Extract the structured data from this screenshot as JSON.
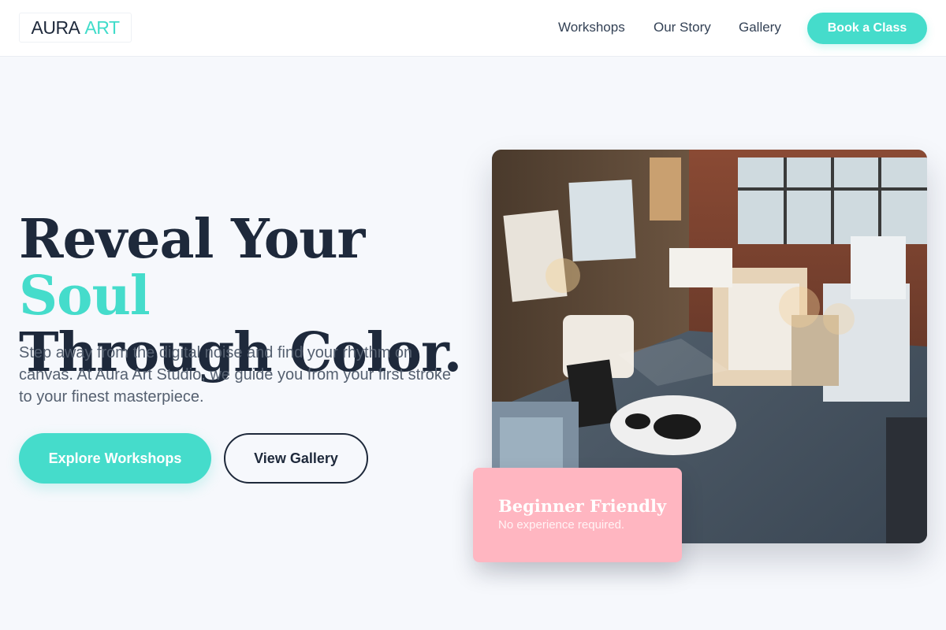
{
  "header": {
    "logo": {
      "word1": "AURA",
      "word2": "ART"
    },
    "nav": [
      {
        "label": "Workshops"
      },
      {
        "label": "Our Story"
      },
      {
        "label": "Gallery"
      }
    ],
    "cta_label": "Book a Class"
  },
  "hero": {
    "headline_part1": "Reveal Your ",
    "headline_accent": "Soul",
    "headline_part2": "Through Color.",
    "subtext": "Step away from the digital noise and find your rhythm on canvas. At Aura Art Studio, we guide you from your first stroke to your finest masterpiece.",
    "primary_button": "Explore Workshops",
    "secondary_button": "View Gallery",
    "image_icon": "art-studio-photo",
    "badge": {
      "title": "Beginner Friendly",
      "subtitle": "No experience required."
    }
  },
  "colors": {
    "accent": "#45dccb",
    "dark": "#1e293b",
    "badge_pink": "#ffb6c1",
    "background": "#f6f8fc"
  }
}
